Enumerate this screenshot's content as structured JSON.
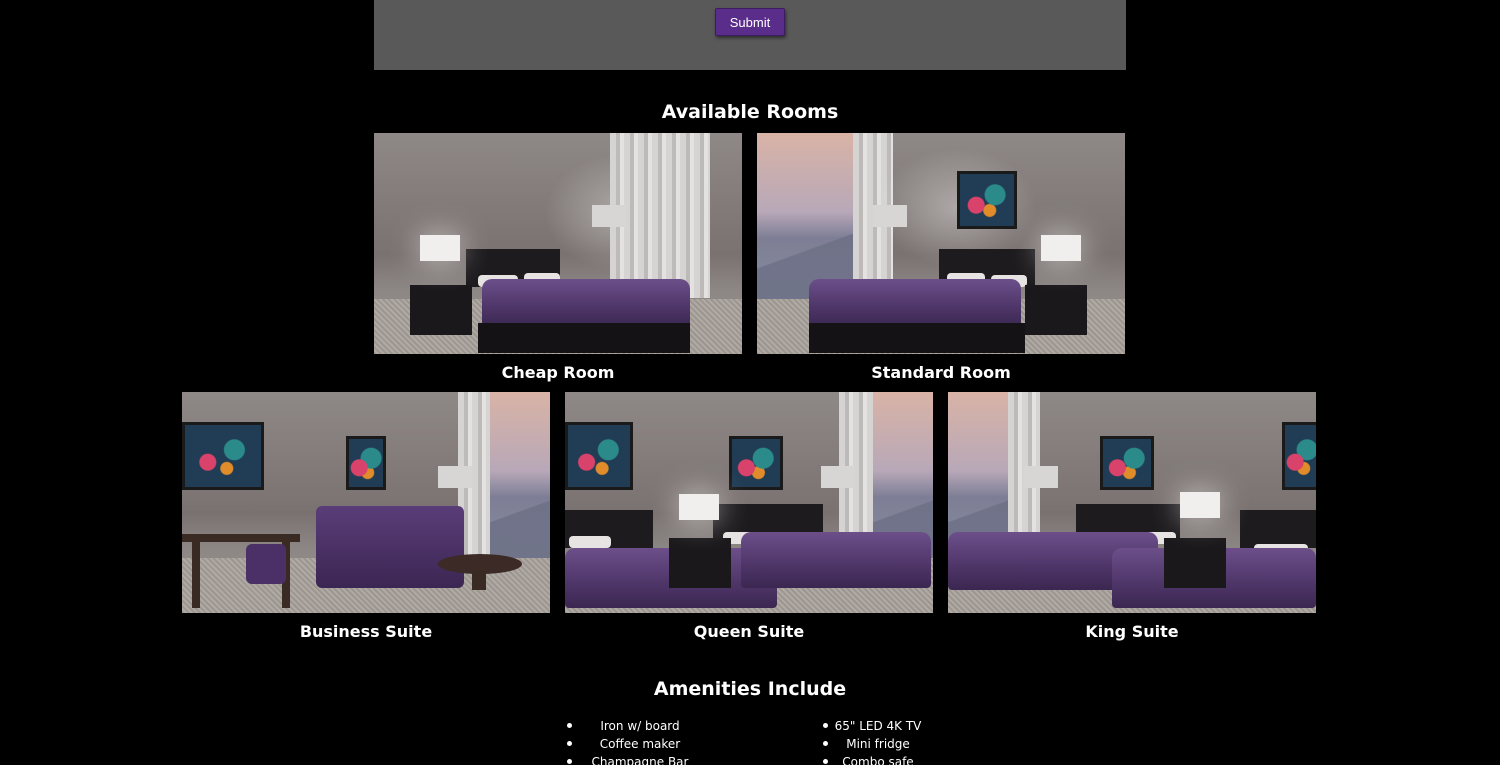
{
  "form": {
    "submit_label": "Submit"
  },
  "rooms_section": {
    "heading": "Available Rooms",
    "rooms": [
      {
        "name": "Cheap Room"
      },
      {
        "name": "Standard Room"
      },
      {
        "name": "Business Suite"
      },
      {
        "name": "Queen Suite"
      },
      {
        "name": "King Suite"
      }
    ]
  },
  "amenities_section": {
    "heading": "Amenities Include",
    "left_items": [
      "Iron w/ board",
      "Coffee maker",
      "Champagne Bar"
    ],
    "right_items": [
      "65\" LED 4K TV",
      "Mini fridge",
      "Combo safe"
    ]
  },
  "colors": {
    "background": "#000000",
    "form_panel": "#595959",
    "accent_purple": "#5a2d8a",
    "text": "#ffffff"
  }
}
